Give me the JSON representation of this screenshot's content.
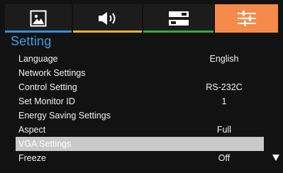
{
  "tabs": [
    {
      "name": "picture",
      "icon": "picture-icon",
      "underline_color": "#3a8fd6"
    },
    {
      "name": "audio",
      "icon": "speaker-icon",
      "underline_color": "#e2b632"
    },
    {
      "name": "layout",
      "icon": "layout-icon",
      "underline_color": "#3aa845"
    },
    {
      "name": "settings",
      "icon": "sliders-icon",
      "active": true,
      "accent_color": "#f58a4a"
    }
  ],
  "menu": {
    "title": "Setting",
    "items": [
      {
        "label": "Language",
        "value": "English"
      },
      {
        "label": "Network Settings",
        "value": ""
      },
      {
        "label": "Control Setting",
        "value": "RS-232C"
      },
      {
        "label": "Set Monitor ID",
        "value": "1"
      },
      {
        "label": "Energy Saving Settings",
        "value": ""
      },
      {
        "label": "Aspect",
        "value": "Full"
      },
      {
        "label": "VGA Settings",
        "value": "",
        "selected": true
      },
      {
        "label": "Freeze",
        "value": "Off"
      }
    ]
  },
  "colors": {
    "background": "#121212",
    "title": "#3f9fe0",
    "selection": "#c9c9c9"
  },
  "scroll": {
    "icon": "scroll-down-arrow-icon"
  }
}
